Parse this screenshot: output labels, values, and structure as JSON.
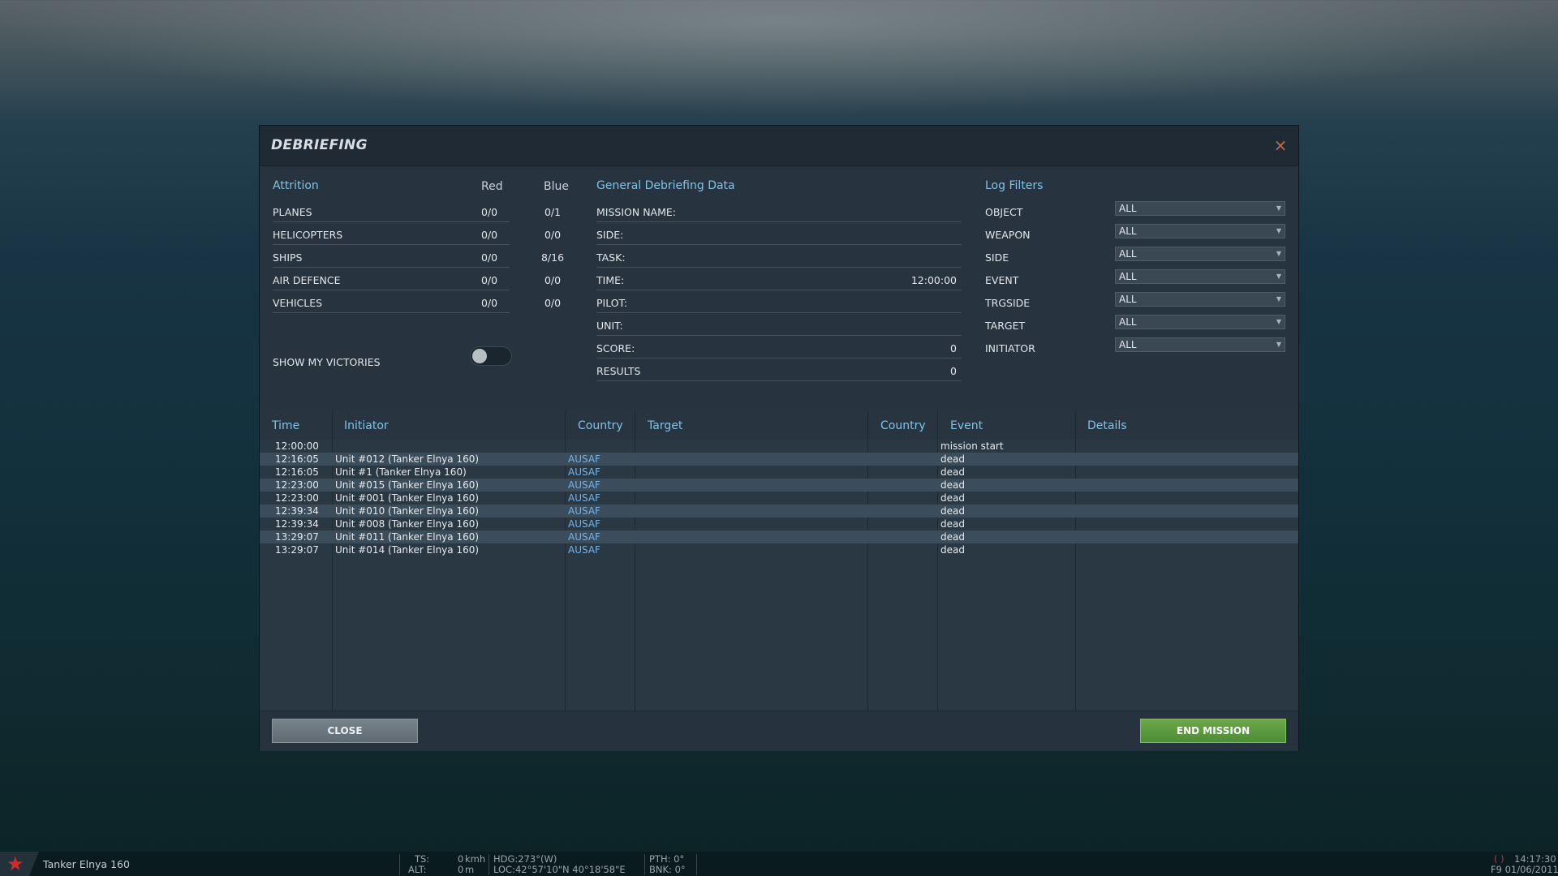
{
  "dialog": {
    "title": "DEBRIEFING",
    "close_icon": "×"
  },
  "attrition": {
    "heading": "Attrition",
    "col_red": "Red",
    "col_blue": "Blue",
    "rows": [
      {
        "label": "PLANES",
        "red": "0/0",
        "blue": "0/1"
      },
      {
        "label": "HELICOPTERS",
        "red": "0/0",
        "blue": "0/0"
      },
      {
        "label": "SHIPS",
        "red": "0/0",
        "blue": "8/16"
      },
      {
        "label": "AIR DEFENCE",
        "red": "0/0",
        "blue": "0/0"
      },
      {
        "label": "VEHICLES",
        "red": "0/0",
        "blue": "0/0"
      }
    ],
    "show_victories_label": "SHOW MY VICTORIES",
    "show_victories_on": false
  },
  "general": {
    "heading": "General Debriefing Data",
    "rows": [
      {
        "label": "MISSION NAME:",
        "value": ""
      },
      {
        "label": "SIDE:",
        "value": ""
      },
      {
        "label": "TASK:",
        "value": ""
      },
      {
        "label": "TIME:",
        "value": "12:00:00"
      },
      {
        "label": "PILOT:",
        "value": ""
      },
      {
        "label": "UNIT:",
        "value": ""
      },
      {
        "label": "SCORE:",
        "value": "0"
      },
      {
        "label": "RESULTS",
        "value": "0"
      }
    ]
  },
  "filters": {
    "heading": "Log Filters",
    "rows": [
      {
        "label": "OBJECT",
        "value": "ALL"
      },
      {
        "label": "WEAPON",
        "value": "ALL"
      },
      {
        "label": "SIDE",
        "value": "ALL"
      },
      {
        "label": "EVENT",
        "value": "ALL"
      },
      {
        "label": "TRGSIDE",
        "value": "ALL"
      },
      {
        "label": "TARGET",
        "value": "ALL"
      },
      {
        "label": "INITIATOR",
        "value": "ALL"
      }
    ]
  },
  "log": {
    "columns": [
      "Time",
      "Initiator",
      "Country",
      "Target",
      "Country",
      "Event",
      "Details"
    ],
    "rows": [
      {
        "time": "12:00:00",
        "initiator": "",
        "country": "",
        "target": "",
        "target_country": "",
        "event": "mission start",
        "details": ""
      },
      {
        "time": "12:16:05",
        "initiator": "Unit #012 (Tanker Elnya 160)",
        "country": "AUSAF",
        "target": "",
        "target_country": "",
        "event": "dead",
        "details": ""
      },
      {
        "time": "12:16:05",
        "initiator": "Unit #1 (Tanker Elnya 160)",
        "country": "AUSAF",
        "target": "",
        "target_country": "",
        "event": "dead",
        "details": ""
      },
      {
        "time": "12:23:00",
        "initiator": "Unit #015 (Tanker Elnya 160)",
        "country": "AUSAF",
        "target": "",
        "target_country": "",
        "event": "dead",
        "details": ""
      },
      {
        "time": "12:23:00",
        "initiator": "Unit #001 (Tanker Elnya 160)",
        "country": "AUSAF",
        "target": "",
        "target_country": "",
        "event": "dead",
        "details": ""
      },
      {
        "time": "12:39:34",
        "initiator": "Unit #010 (Tanker Elnya 160)",
        "country": "AUSAF",
        "target": "",
        "target_country": "",
        "event": "dead",
        "details": ""
      },
      {
        "time": "12:39:34",
        "initiator": "Unit #008 (Tanker Elnya 160)",
        "country": "AUSAF",
        "target": "",
        "target_country": "",
        "event": "dead",
        "details": ""
      },
      {
        "time": "13:29:07",
        "initiator": "Unit #011 (Tanker Elnya 160)",
        "country": "AUSAF",
        "target": "",
        "target_country": "",
        "event": "dead",
        "details": ""
      },
      {
        "time": "13:29:07",
        "initiator": "Unit #014 (Tanker Elnya 160)",
        "country": "AUSAF",
        "target": "",
        "target_country": "",
        "event": "dead",
        "details": ""
      }
    ]
  },
  "footer": {
    "close_label": "CLOSE",
    "end_label": "END MISSION"
  },
  "statusbar": {
    "star_icon": "★",
    "unit_name": "Tanker Elnya 160",
    "ts_label": "TS:",
    "ts_value": "0",
    "ts_unit": "kmh",
    "alt_label": "ALT:",
    "alt_value": "0",
    "alt_unit": "m",
    "hdg": "HDG:273°(W)",
    "loc": "LOC:42°57'10\"N 40°18'58\"E",
    "pth": "PTH: 0°",
    "bnk": "BNK: 0°",
    "brackets": "( )",
    "clock": "14:17:30",
    "date": "F9 01/06/2011"
  },
  "colors": {
    "accent": "#7ec3e8",
    "country": "#6fb4ea",
    "close_icon": "#c96a4a",
    "end_mission": "#5b9a3f"
  }
}
